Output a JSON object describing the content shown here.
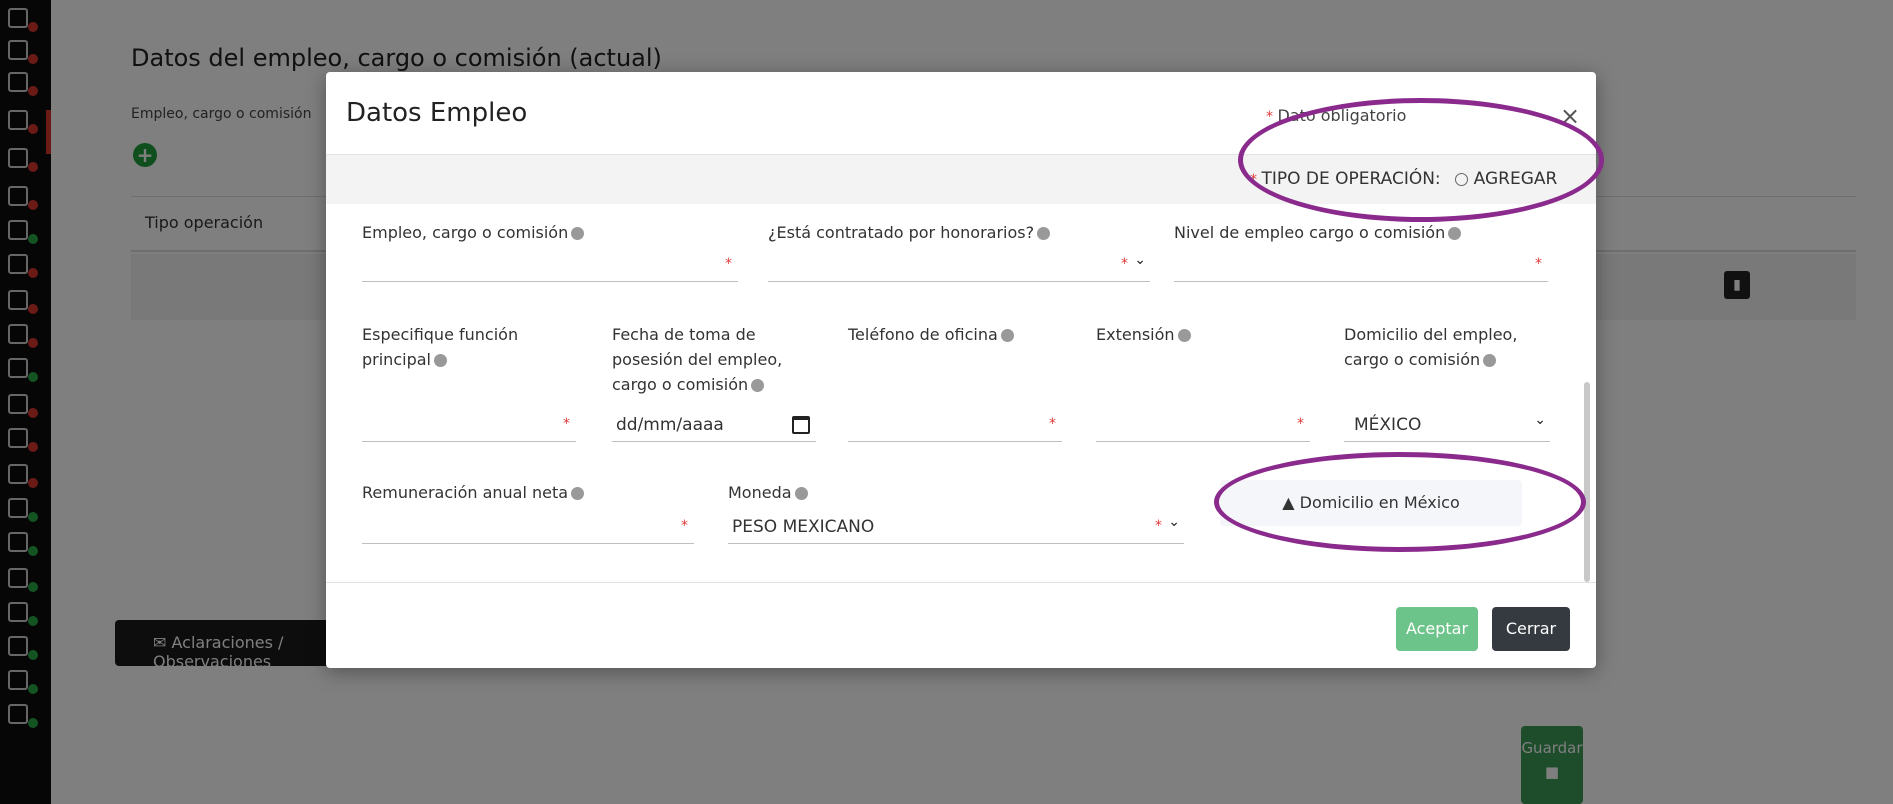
{
  "background": {
    "title": "Datos del empleo, cargo o comisión (actual)",
    "subtitle": "Empleo, cargo o comisión",
    "table_header": "Tipo operación",
    "observaciones_button": "Aclaraciones / Observaciones",
    "guardar_button": "Guardar"
  },
  "modal": {
    "title": "Datos Empleo",
    "required_note": "Dato obligatorio",
    "tipo_operacion_label": "TIPO DE OPERACIÓN:",
    "tipo_operacion_value": "AGREGAR",
    "fields": {
      "empleo": {
        "label": "Empleo, cargo o comisión",
        "value": ""
      },
      "honorarios": {
        "label": "¿Está contratado por honorarios?",
        "value": ""
      },
      "nivel": {
        "label": "Nivel de empleo cargo o comisión",
        "value": ""
      },
      "funcion": {
        "label": "Especifique función principal",
        "value": ""
      },
      "fecha": {
        "label": "Fecha de toma de posesión del empleo, cargo o comisión",
        "placeholder": "dd/mm/aaaa"
      },
      "telefono": {
        "label": "Teléfono de oficina",
        "value": ""
      },
      "extension": {
        "label": "Extensión",
        "value": ""
      },
      "domicilio": {
        "label": "Domicilio del empleo, cargo o comisión",
        "value": "MÉXICO"
      },
      "remuneracion": {
        "label": "Remuneración anual neta",
        "value": ""
      },
      "moneda": {
        "label": "Moneda",
        "value": "PESO MEXICANO"
      }
    },
    "domicilio_button": "Domicilio en México",
    "aceptar": "Aceptar",
    "cerrar": "Cerrar"
  },
  "annotation_color": "#8a2a8c"
}
